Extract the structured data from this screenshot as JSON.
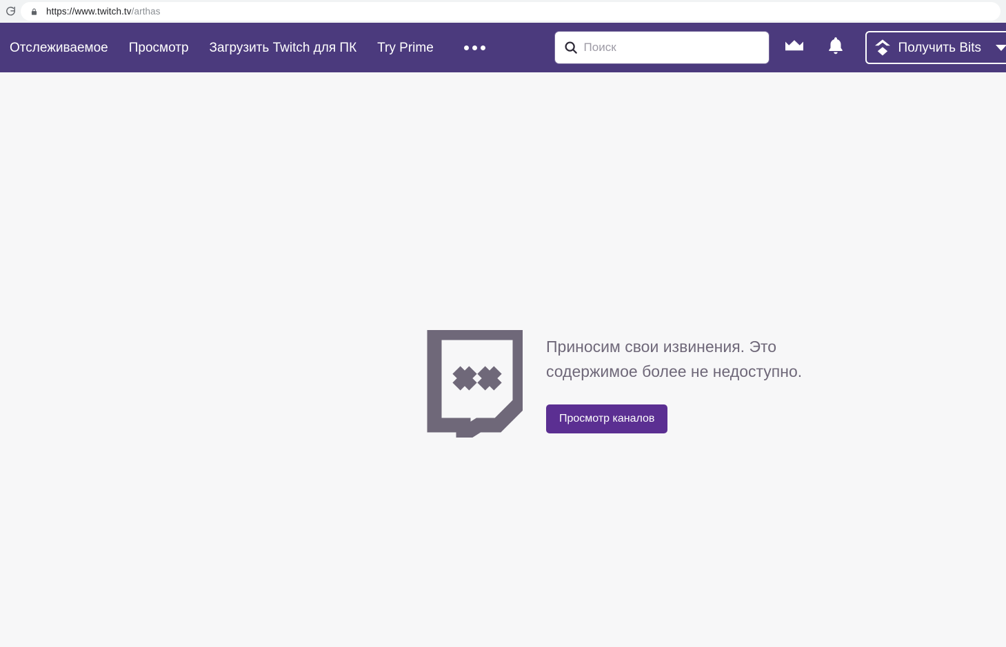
{
  "browser": {
    "reload_icon": "reload-icon",
    "lock_icon": "lock-icon",
    "url_domain": "https://www.twitch.tv",
    "url_path": "/arthas"
  },
  "nav": {
    "links": [
      {
        "label": "Отслеживаемое",
        "name": "nav-link-following"
      },
      {
        "label": "Просмотр",
        "name": "nav-link-browse"
      },
      {
        "label": "Загрузить Twitch для ПК",
        "name": "nav-link-download"
      },
      {
        "label": "Try Prime",
        "name": "nav-link-try-prime"
      }
    ],
    "more_menu": "more-menu-icon",
    "search": {
      "placeholder": "Поиск",
      "value": "",
      "icon": "search-icon"
    },
    "crown_icon": "crown-icon",
    "bell_icon": "bell-icon",
    "bits_button": {
      "label": "Получить Bits",
      "icon": "bits-icon",
      "caret": "chevron-down-icon"
    },
    "background_color": "#4b3a7d"
  },
  "sidebar": {
    "expand_arrow": "chevron-right-icon"
  },
  "main": {
    "glitch_logo": "twitch-glitch-dead-icon",
    "error_message": "Приносим свои извинения. Это содержимое более не недоступно.",
    "browse_button_label": "Просмотр каналов",
    "button_color": "#5b2f92",
    "text_color": "#6f6879",
    "background_color": "#f7f7f8"
  }
}
